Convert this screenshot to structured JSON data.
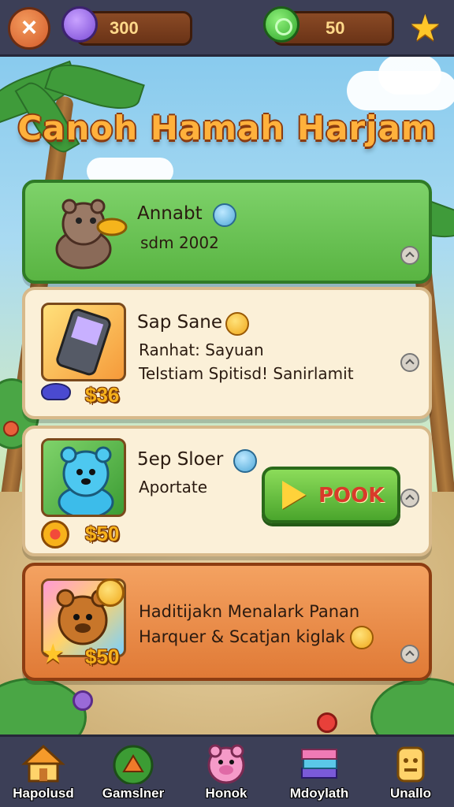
{
  "topbar": {
    "gems_value": "300",
    "coins_value": "50"
  },
  "title": "Canoh Hamah Harjam",
  "cards": [
    {
      "name": "Annabt",
      "subtitle": "sdm 2002"
    },
    {
      "name": "Sap Sane",
      "line1": "Ranhat: Sayuan",
      "line2": "Telstiam Spitisd! Sanirlamit",
      "price": "$36"
    },
    {
      "name": "5ep Sloer",
      "line1": "Aportate",
      "price": "$50",
      "button_label": "POOK"
    },
    {
      "line1": "Haditijakn Menalark Panan",
      "line2": "Harquer & Scatjan kiglak",
      "price": "$50"
    }
  ],
  "nav": [
    {
      "label": "Hapolusd",
      "icon": "house-icon"
    },
    {
      "label": "Gamslner",
      "icon": "fox-icon"
    },
    {
      "label": "Honok",
      "icon": "pig-icon"
    },
    {
      "label": "Mdoylath",
      "icon": "books-icon"
    },
    {
      "label": "Unallo",
      "icon": "block-icon"
    }
  ],
  "colors": {
    "topbar": "#3c3f57",
    "title": "#ffb13c",
    "price": "#f7b21b",
    "card_green": "#59b442",
    "card_orange": "#e07a36"
  }
}
